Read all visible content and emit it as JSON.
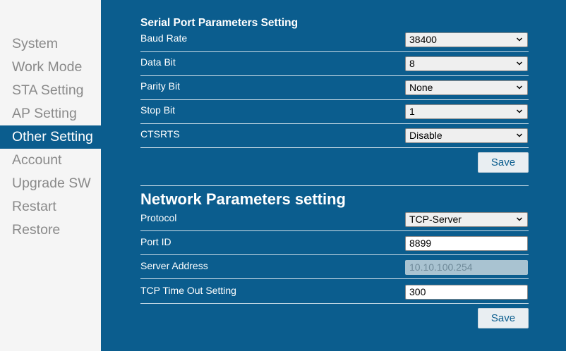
{
  "sidebar": {
    "items": [
      {
        "label": "System"
      },
      {
        "label": "Work Mode"
      },
      {
        "label": "STA Setting"
      },
      {
        "label": "AP Setting"
      },
      {
        "label": "Other Setting",
        "active": true
      },
      {
        "label": "Account"
      },
      {
        "label": "Upgrade SW"
      },
      {
        "label": "Restart"
      },
      {
        "label": "Restore"
      }
    ]
  },
  "serial": {
    "title": "Serial Port Parameters Setting",
    "baud_rate": {
      "label": "Baud Rate",
      "value": "38400"
    },
    "data_bit": {
      "label": "Data Bit",
      "value": "8"
    },
    "parity_bit": {
      "label": "Parity Bit",
      "value": "None"
    },
    "stop_bit": {
      "label": "Stop Bit",
      "value": "1"
    },
    "ctsrts": {
      "label": "CTSRTS",
      "value": "Disable"
    },
    "save_label": "Save"
  },
  "network": {
    "title": "Network Parameters setting",
    "protocol": {
      "label": "Protocol",
      "value": "TCP-Server"
    },
    "port_id": {
      "label": "Port ID",
      "value": "8899"
    },
    "server_address": {
      "label": "Server Address",
      "value": "10.10.100.254"
    },
    "tcp_timeout": {
      "label": "TCP Time Out Setting",
      "value": "300"
    },
    "save_label": "Save"
  },
  "colors": {
    "accent": "#0b5d8e",
    "sidebar_bg": "#f5f5f5",
    "nav_text": "#8a8a8a"
  },
  "icons": {
    "select": "chevron-down-icon"
  }
}
